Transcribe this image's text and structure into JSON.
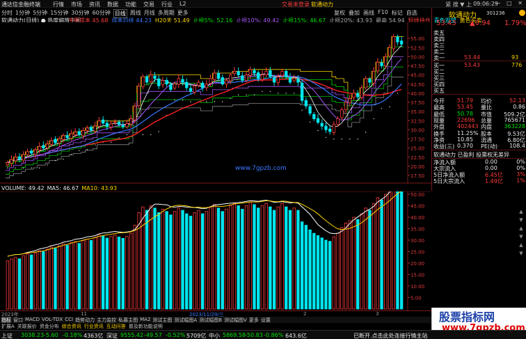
{
  "menubar": {
    "app_name": "通达信金融终端",
    "menus": [
      "行情",
      "市场",
      "资讯",
      "数据",
      "功能",
      "交易",
      "行业",
      "L2"
    ],
    "notice": "交易未登录",
    "stock_name": "软通动力",
    "tools": "紧 搜 ▼ 上",
    "clock": "09:06:29",
    "window_buttons": "— □ ✕"
  },
  "periodbar": {
    "items": [
      "分时",
      "1分钟",
      "5分钟",
      "15分钟",
      "30分钟",
      "60分钟",
      "日线",
      "周线",
      "月线",
      "多周期",
      "更多"
    ],
    "active": "日线",
    "right_items": [
      "复权",
      "叠加",
      "画线",
      "F10",
      "标记",
      "自选"
    ]
  },
  "chart_title": "软通动力(日线) ● 热度缩放主图",
  "indicators": [
    {
      "text": "主图成本 45.68",
      "color": "#ff3b3b"
    },
    {
      "text": "成本均线 44.23",
      "color": "#3a78ff"
    },
    {
      "text": "H20天 51.49",
      "color": "#ffd700"
    },
    {
      "text": "止损5%: 52.16",
      "color": "#00e000"
    },
    {
      "text": "止损10%: 49.42",
      "color": "#a855f7"
    },
    {
      "text": "止损15%: 46.67",
      "color": "#00e000"
    },
    {
      "text": "止损20%: 43.93",
      "color": "#aaaaaa"
    },
    {
      "text": "最高 54.94",
      "color": "#aaaaaa"
    },
    {
      "text": "短线持仓",
      "color": "#ff3b3b"
    },
    {
      "text": "青色观望",
      "color": "#00e5ee"
    },
    {
      "text": "黄色买卖",
      "color": "#ffd700"
    }
  ],
  "watermark": "www.7gpzb.com",
  "volume_legend": [
    {
      "text": "VOLUME: 49.42",
      "color": "#e8e8e8"
    },
    {
      "text": "MA5: 46.67",
      "color": "#e8e8e8"
    },
    {
      "text": "MA10: 43.93",
      "color": "#ffd700"
    }
  ],
  "datebar": [
    {
      "text": "2023年",
      "color": "#999"
    },
    {
      "text": "11",
      "color": "#999"
    },
    {
      "text": "2023/11/29/三",
      "color": "#3a78ff"
    },
    {
      "text": "2",
      "color": "#999"
    },
    {
      "text": "3",
      "color": "#999"
    }
  ],
  "tabs": [
    "指标",
    "窗口",
    "MACD",
    "VOL-TDX",
    "CCI",
    "趋势动力",
    "主力监控",
    "私募主图",
    "MA2",
    "测试主图",
    "测试幅图A",
    "测试幅图B",
    "测试幅图V",
    "更多",
    "设置"
  ],
  "active_tab": "指标",
  "subtabs": [
    "扩展A",
    "关联报价",
    "资金分布",
    "综合资讯",
    "行业资讯",
    "互动问答",
    "普及新功能说明"
  ],
  "highlighted_subtabs": [
    "综合资讯",
    "行业资讯",
    "互动问答"
  ],
  "quote": {
    "name": "软通动力",
    "code": "301236",
    "price": "53.43",
    "change": "▲0.94",
    "pct": "1.79%",
    "order_book": [
      {
        "label": "卖五",
        "price": "",
        "vol": ""
      },
      {
        "label": "卖四",
        "price": "",
        "vol": ""
      },
      {
        "label": "卖三",
        "price": "",
        "vol": ""
      },
      {
        "label": "卖二",
        "price": "",
        "vol": ""
      },
      {
        "label": "卖一",
        "price": "53.44",
        "vol": "93"
      },
      {
        "label": "买一",
        "price": "53.43",
        "vol": "776"
      },
      {
        "label": "买二",
        "price": "",
        "vol": ""
      },
      {
        "label": "买三",
        "price": "",
        "vol": ""
      },
      {
        "label": "买四",
        "price": "",
        "vol": ""
      },
      {
        "label": "买五",
        "price": "",
        "vol": ""
      }
    ],
    "stats": [
      {
        "l1": "今开",
        "v1": "51.79",
        "c1": "red",
        "l2": "均价",
        "v2": "52.13",
        "c2": "red"
      },
      {
        "l1": "最高",
        "v1": "53.45",
        "c1": "red",
        "l2": "量比",
        "v2": "0.86",
        "c2": "white"
      },
      {
        "l1": "最低",
        "v1": "50.78",
        "c1": "green",
        "l2": "市值",
        "v2": "509.2亿",
        "c2": "white"
      },
      {
        "l1": "现量",
        "v1": "22696",
        "c1": "red",
        "l2": "总量",
        "v2": "765671",
        "c2": "white"
      },
      {
        "l1": "外盘",
        "v1": "402443",
        "c1": "red",
        "l2": "内盘",
        "v2": "363228",
        "c2": "green"
      },
      {
        "l1": "换手",
        "v1": "11.25%",
        "c1": "white",
        "l2": "股本",
        "v2": "9.53亿",
        "c2": "white"
      },
      {
        "l1": "净资",
        "v1": "10.85",
        "c1": "white",
        "l2": "流通",
        "v2": "6.80亿",
        "c2": "white"
      },
      {
        "l1": "收益(三)",
        "v1": "0.370",
        "c1": "white",
        "l2": "PE(动)",
        "v2": "108.4",
        "c2": "white"
      }
    ],
    "extra": "软通动力 已盈利 投票权无差异",
    "flows": [
      {
        "label": "净流入额",
        "v1": "0.00",
        "v2": "0%",
        "c": "white"
      },
      {
        "label": "大宗流入",
        "v1": "0.00",
        "v2": "0%",
        "c": "white"
      },
      {
        "label": "5日净流入额",
        "v1": "6.45亿",
        "v2": "3%",
        "c": "red"
      },
      {
        "label": "5日大宗流入",
        "v1": "1.49亿",
        "v2": "1%",
        "c": "red"
      }
    ]
  },
  "chart_data": {
    "type": "candlestick",
    "title": "软通动力(日线)",
    "ylim": [
      17.5,
      57.5
    ],
    "y_ticks": [
      "55.00",
      "52.50",
      "50.00",
      "47.50",
      "45.00",
      "42.50",
      "40.00",
      "37.50",
      "35.00",
      "32.50",
      "30.00",
      "27.50",
      "25.00",
      "22.50",
      "20.00",
      "17.50"
    ],
    "series_close": [
      21.0,
      21.8,
      22.5,
      21.9,
      23.2,
      24.0,
      23.6,
      24.5,
      25.4,
      25.0,
      26.1,
      27.0,
      26.4,
      27.5,
      28.4,
      27.8,
      28.9,
      29.4,
      28.6,
      29.8,
      30.5,
      29.9,
      31.0,
      32.4,
      31.8,
      30.9,
      31.6,
      32.2,
      31.4,
      30.8,
      31.7,
      33.0,
      36.5,
      42.0,
      44.5,
      43.0,
      45.0,
      44.0,
      42.0,
      43.5,
      42.5,
      41.0,
      42.5,
      44.0,
      43.0,
      41.5,
      40.5,
      42.0,
      43.0,
      41.5,
      42.5,
      44.0,
      45.5,
      44.0,
      42.5,
      43.5,
      45.0,
      46.0,
      45.0,
      43.5,
      45.0,
      46.5,
      45.5,
      44.0,
      45.0,
      46.0,
      44.5,
      43.0,
      44.5,
      46.0,
      44.5,
      43.0,
      44.0,
      43.0,
      38.0,
      36.5,
      34.5,
      33.0,
      32.0,
      31.0,
      30.0,
      29.5,
      31.5,
      33.0,
      35.5,
      37.5,
      38.5,
      40.0,
      39.0,
      41.5,
      44.0,
      43.0,
      46.0,
      48.5,
      47.5,
      50.0,
      52.5,
      55.5,
      54.0,
      53.43
    ],
    "volume_ylim": [
      0,
      50
    ],
    "volume_ticks": [
      "50.00",
      "45.00",
      "40.00",
      "35.00",
      "30.00",
      "25.00",
      "20.00",
      "15.00",
      "10.00",
      "5.00"
    ]
  },
  "statusbar": [
    {
      "text": "上证",
      "color": "#e8e8e8"
    },
    {
      "text": "3038.23",
      "color": "#00e000"
    },
    {
      "text": "-5.60",
      "color": "#00e000"
    },
    {
      "text": "-0.18%",
      "color": "#00e000"
    },
    {
      "text": "4363亿",
      "color": "#e8e8e8"
    },
    {
      "text": "深证",
      "color": "#e8e8e8"
    },
    {
      "text": "9555.42",
      "color": "#00e000"
    },
    {
      "text": "-49.57",
      "color": "#00e000"
    },
    {
      "text": "-0.52%",
      "color": "#00e000"
    },
    {
      "text": "5709亿",
      "color": "#e8e8e8"
    },
    {
      "text": "中小",
      "color": "#e8e8e8"
    },
    {
      "text": "5869.58",
      "color": "#00e000"
    },
    {
      "text": "-50.83",
      "color": "#00e000"
    },
    {
      "text": "-0.86%",
      "color": "#00e000"
    },
    {
      "text": "643.6亿",
      "color": "#e8e8e8"
    },
    {
      "text": "已断开.点击此处连接行情主站",
      "color": "#e8e8e8"
    }
  ],
  "promo": {
    "line1": "股票指标网",
    "line2": "www.7gpzb.com"
  },
  "colors": {
    "up": "#ff3b3b",
    "down": "#00e5ee",
    "frame": "#7a1a1a",
    "accent": "#ffd700"
  }
}
